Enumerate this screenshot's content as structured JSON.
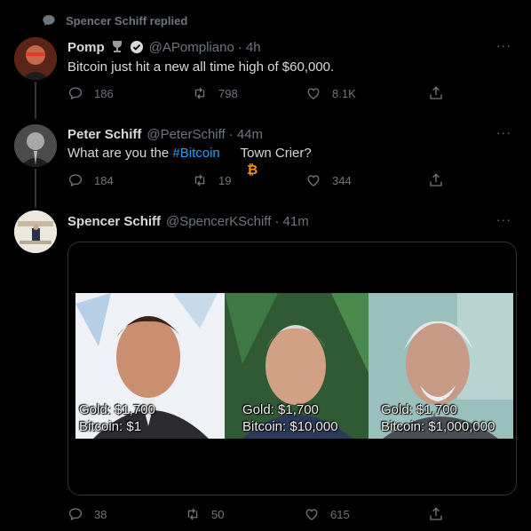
{
  "context": {
    "replied_label": "Spencer Schiff replied"
  },
  "tweets": [
    {
      "name": "Pomp",
      "handle": "@APompliano",
      "time": "· 4h",
      "text": "Bitcoin just hit a new all time high of $60,000.",
      "replies": "186",
      "retweets": "798",
      "likes": "8.1K"
    },
    {
      "name": "Peter Schiff",
      "handle": "@PeterSchiff",
      "time": "· 44m",
      "text_before": "What are you the ",
      "hashtag": "#Bitcoin",
      "text_after": " Town Crier?",
      "replies": "184",
      "retweets": "19",
      "likes": "344"
    },
    {
      "name": "Spencer Schiff",
      "handle": "@SpencerKSchiff",
      "time": "· 41m",
      "replies": "38",
      "retweets": "50",
      "likes": "615",
      "image_captions": [
        {
          "gold": "Gold: $1,700",
          "bitcoin": "Bitcoin: $1"
        },
        {
          "gold": "Gold: $1,700",
          "bitcoin": "Bitcoin: $10,000"
        },
        {
          "gold": "Gold: $1,700",
          "bitcoin": "Bitcoin: $1,000,000"
        }
      ]
    }
  ],
  "more_label": "···",
  "colors": {
    "accent": "#1da1f2",
    "bitcoin": "#f7931a",
    "muted": "#6e767d",
    "background": "#000000"
  }
}
